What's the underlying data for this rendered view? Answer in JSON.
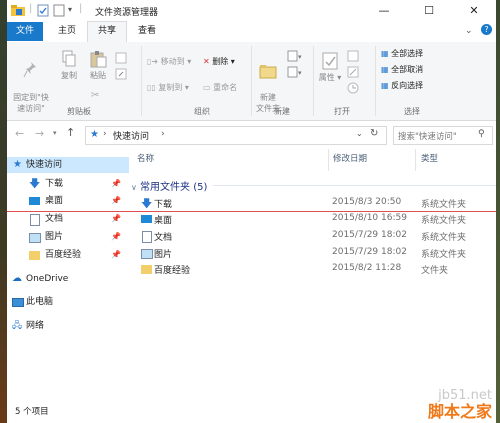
{
  "window": {
    "title": "文件资源管理器",
    "minimize": "—",
    "maximize": "☐",
    "close": "✕"
  },
  "tabs": [
    "文件",
    "主页",
    "共享",
    "查看"
  ],
  "ribbon": {
    "clipboard": {
      "pin": "固定到\"快\n速访问\"",
      "copy": "复制",
      "paste": "粘贴",
      "label": "剪贴板"
    },
    "organize": {
      "move": "移动到",
      "copy": "复制到",
      "delete": "删除",
      "rename": "重命名",
      "label": "组织"
    },
    "new": {
      "folder": "新建\n文件夹",
      "label": "新建"
    },
    "open": {
      "props": "属性",
      "label": "打开"
    },
    "select": {
      "all": "全部选择",
      "none": "全部取消",
      "invert": "反向选择",
      "label": "选择"
    }
  },
  "address": {
    "path": "快速访问",
    "search_placeholder": "搜索\"快速访问\""
  },
  "nav": {
    "quick": "快速访问",
    "items": [
      "下载",
      "桌面",
      "文档",
      "图片",
      "百度经验"
    ],
    "onedrive": "OneDrive",
    "pc": "此电脑",
    "network": "网络"
  },
  "columns": {
    "name": "名称",
    "date": "修改日期",
    "type": "类型"
  },
  "group": "常用文件夹 (5)",
  "files": [
    {
      "name": "下载",
      "date": "2015/8/3 20:50",
      "type": "系统文件夹",
      "icon": "download-folder-icon"
    },
    {
      "name": "桌面",
      "date": "2015/8/10 16:59",
      "type": "系统文件夹",
      "icon": "desktop-folder-icon"
    },
    {
      "name": "文档",
      "date": "2015/7/29 18:02",
      "type": "系统文件夹",
      "icon": "documents-folder-icon"
    },
    {
      "name": "图片",
      "date": "2015/7/29 18:02",
      "type": "系统文件夹",
      "icon": "pictures-folder-icon"
    },
    {
      "name": "百度经验",
      "date": "2015/8/2 11:28",
      "type": "文件夹",
      "icon": "folder-icon"
    }
  ],
  "status": "5 个项目",
  "watermark": {
    "site": "jb51.net",
    "name": "脚本之家"
  },
  "colors": {
    "accent": "#1979ca",
    "selection": "#cce8ff",
    "group_text": "#1e3287",
    "red_line": "#e0504f"
  }
}
